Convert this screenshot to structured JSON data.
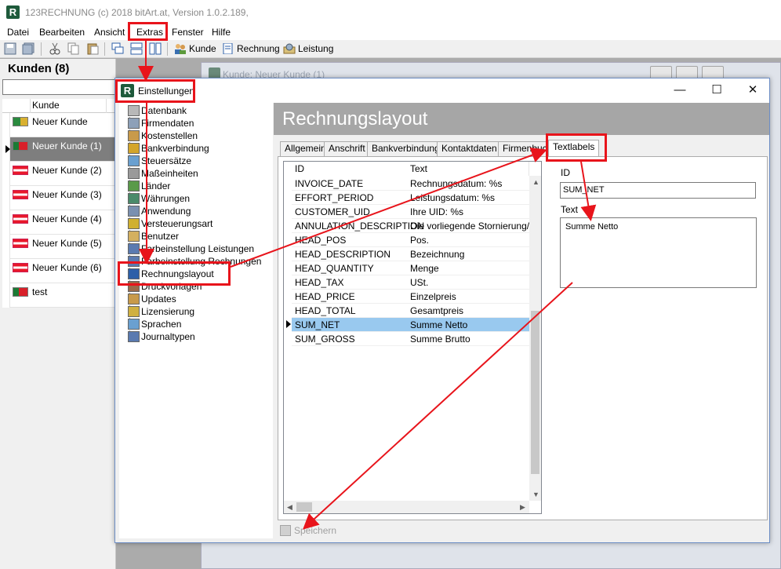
{
  "app": {
    "title": "123RECHNUNG (c) 2018 bitArt.at, Version 1.0.2.189,",
    "logo_letter": "R"
  },
  "menu": [
    "Datei",
    "Bearbeiten",
    "Ansicht",
    "Extras",
    "Fenster",
    "Hilfe"
  ],
  "toolbar": {
    "kunde": "Kunde",
    "rechnung": "Rechnung",
    "leistung": "Leistung"
  },
  "kunden": {
    "title": "Kunden (8)",
    "column": "Kunde",
    "rows": [
      {
        "name": "Neuer Kunde",
        "flag": "ng"
      },
      {
        "name": "Neuer Kunde (1)",
        "flag": "pt"
      },
      {
        "name": "Neuer Kunde (2)",
        "flag": "at"
      },
      {
        "name": "Neuer Kunde (3)",
        "flag": "at"
      },
      {
        "name": "Neuer Kunde (4)",
        "flag": "at"
      },
      {
        "name": "Neuer Kunde (5)",
        "flag": "at"
      },
      {
        "name": "Neuer Kunde (6)",
        "flag": "at"
      },
      {
        "name": "test",
        "flag": "pt"
      }
    ]
  },
  "bg_window": {
    "title": "Kunde: Neuer Kunde (1)"
  },
  "dialog": {
    "title": "Einstellungen",
    "header": "Rechnungslayout",
    "tree": [
      "Datenbank",
      "Firmendaten",
      "Kostenstellen",
      "Bankverbindung",
      "Steuersätze",
      "Maßeinheiten",
      "Länder",
      "Währungen",
      "Anwendung",
      "Versteuerungsart",
      "Benutzer",
      "Farbeinstellung Leistungen",
      "Farbeinstellung Rechnungen",
      "Rechnungslayout",
      "Druckvorlagen",
      "Updates",
      "Lizensierung",
      "Sprachen",
      "Journaltypen"
    ],
    "tabs": [
      "Allgemein",
      "Anschrift",
      "Bankverbindung",
      "Kontaktdaten",
      "Firmenbuch",
      "Textlabels"
    ],
    "list": {
      "col_id": "ID",
      "col_text": "Text",
      "rows": [
        {
          "id": "INVOICE_DATE",
          "text": "Rechnungsdatum: %s"
        },
        {
          "id": "EFFORT_PERIOD",
          "text": "Leistungsdatum: %s"
        },
        {
          "id": "CUSTOMER_UID",
          "text": "Ihre UID: %s"
        },
        {
          "id": "ANNULATION_DESCRIPTION",
          "text": "Die vorliegende Stornierung/Gu"
        },
        {
          "id": "HEAD_POS",
          "text": "Pos."
        },
        {
          "id": "HEAD_DESCRIPTION",
          "text": "Bezeichnung"
        },
        {
          "id": "HEAD_QUANTITY",
          "text": "Menge"
        },
        {
          "id": "HEAD_TAX",
          "text": "USt."
        },
        {
          "id": "HEAD_PRICE",
          "text": "Einzelpreis"
        },
        {
          "id": "HEAD_TOTAL",
          "text": "Gesamtpreis"
        },
        {
          "id": "SUM_NET",
          "text": "Summe Netto"
        },
        {
          "id": "SUM_GROSS",
          "text": "Summe Brutto"
        }
      ]
    },
    "detail": {
      "id_label": "ID",
      "id_value": "SUM_NET",
      "text_label": "Text",
      "text_value": "Summe Netto"
    },
    "save": "Speichern"
  },
  "colors": {
    "highlight": "#e8141b",
    "selection": "#99c9ef",
    "header_bg": "#a6a6a6"
  }
}
